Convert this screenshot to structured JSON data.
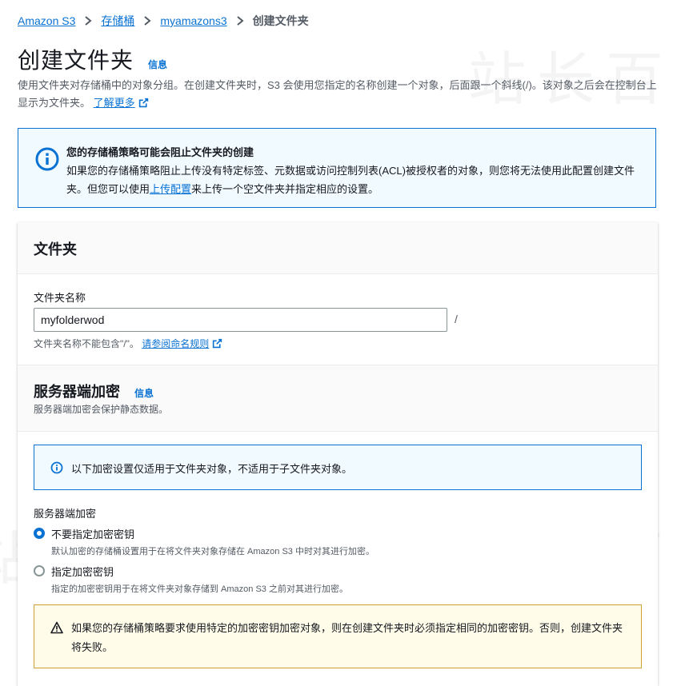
{
  "breadcrumb": {
    "items": [
      "Amazon S3",
      "存储桶",
      "myamazons3"
    ],
    "current": "创建文件夹"
  },
  "header": {
    "title": "创建文件夹",
    "info": "信息",
    "description": "使用文件夹对存储桶中的对象分组。在创建文件夹时，S3 会使用您指定的名称创建一个对象，后面跟一个斜线(/)。该对象之后会在控制台上显示为文件夹。",
    "learn_more": "了解更多"
  },
  "policy_alert": {
    "title": "您的存储桶策略可能会阻止文件夹的创建",
    "body_1": "如果您的存储桶策略阻止上传没有特定标签、元数据或访问控制列表(ACL)被授权者的对象，则您将无法使用此配置创建文件夹。但您可以使用",
    "link": "上传配置",
    "body_2": "来上传一个空文件夹并指定相应的设置。"
  },
  "folder_section": {
    "title": "文件夹",
    "name_label": "文件夹名称",
    "name_value": "myfolderwod",
    "suffix": "/",
    "constraint": "文件夹名称不能包含\"/\"。",
    "naming_rules": "请参阅命名规则"
  },
  "encryption_section": {
    "title": "服务器端加密",
    "info": "信息",
    "description": "服务器端加密会保护静态数据。",
    "notice": "以下加密设置仅适用于文件夹对象，不适用于子文件夹对象。",
    "group_label": "服务器端加密",
    "options": [
      {
        "label": "不要指定加密密钥",
        "description": "默认加密的存储桶设置用于在将文件夹对象存储在 Amazon S3 中时对其进行加密。",
        "checked": true
      },
      {
        "label": "指定加密密钥",
        "description": "指定的加密密钥用于在将文件夹对象存储到 Amazon S3 之前对其进行加密。",
        "checked": false
      }
    ],
    "warning": "如果您的存储桶策略要求使用特定的加密密钥加密对象，则在创建文件夹时必须指定相同的加密密钥。否则，创建文件夹将失败。"
  },
  "watermark": "站长百科",
  "colors": {
    "link": "#0972d3",
    "info_bg": "#f1faff",
    "warn_border": "#d09e35",
    "warn_bg": "#fffce9"
  }
}
